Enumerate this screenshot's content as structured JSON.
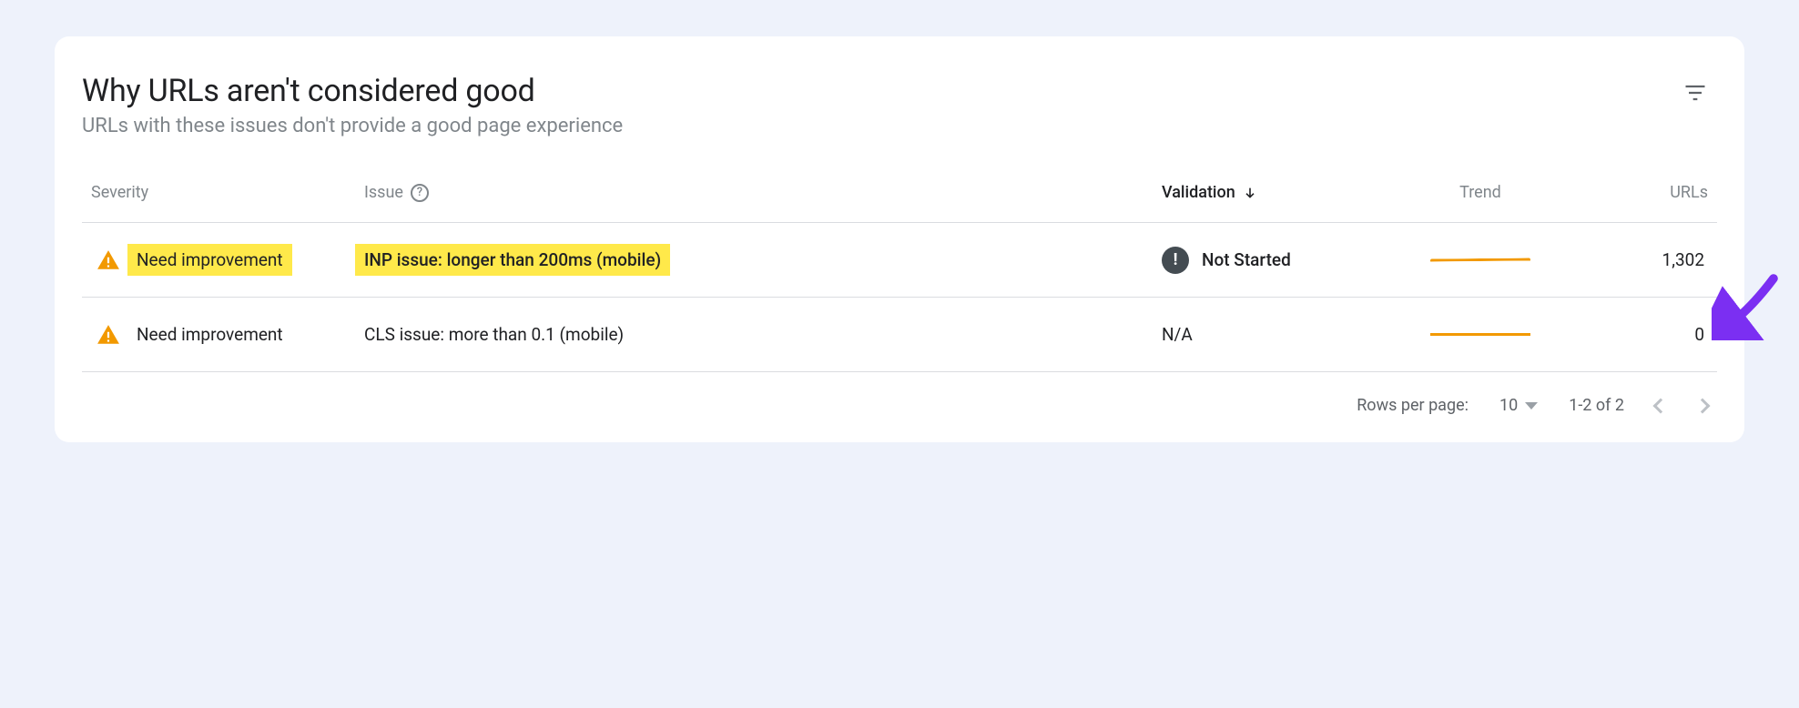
{
  "header": {
    "title": "Why URLs aren't considered good",
    "subtitle": "URLs with these issues don't provide a good page experience"
  },
  "columns": {
    "severity": "Severity",
    "issue": "Issue",
    "validation": "Validation",
    "trend": "Trend",
    "urls": "URLs"
  },
  "rows": [
    {
      "severity": "Need improvement",
      "issue": "INP issue: longer than 200ms (mobile)",
      "validation": "Not Started",
      "validation_icon": true,
      "urls": "1,302",
      "highlighted": true
    },
    {
      "severity": "Need improvement",
      "issue": "CLS issue: more than 0.1 (mobile)",
      "validation": "N/A",
      "validation_icon": false,
      "urls": "0",
      "highlighted": false
    }
  ],
  "pagination": {
    "rows_label": "Rows per page:",
    "rows_value": "10",
    "range": "1-2 of 2"
  }
}
